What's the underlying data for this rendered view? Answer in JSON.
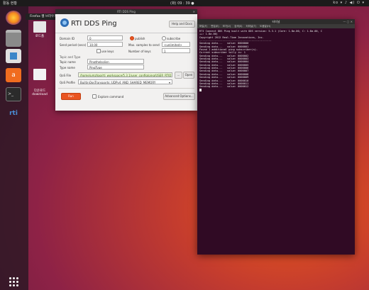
{
  "topbar": {
    "activities": "활동 현황",
    "clock": "(화) 09 : 39 ●",
    "tray": "ko ▾   ♪  ◀)  ⏻ ▾"
  },
  "dock": {
    "tooltip": "Firefox 웹 브라우저",
    "icons": [
      "firefox-icon",
      "files-icon",
      "software-icon",
      "amazon-icon",
      "terminal-icon",
      "rti-icon"
    ]
  },
  "desktop": [
    {
      "name": "desktop-folder-home",
      "label": "로드폴"
    },
    {
      "name": "desktop-folder-download",
      "label": "다운로드\ndownload"
    }
  ],
  "ping": {
    "window_title": "RTI DDS Ping",
    "title": "RTI DDS Ping",
    "help_label": "Help and Docs",
    "domain_label": "Domain ID",
    "domain_value": "0",
    "publish_label": "publish",
    "subscribe_label": "subscribe",
    "send_period_label": "Send period (secs)",
    "send_period_value": "10.00",
    "max_samples_label": "Max. samples to send",
    "max_samples_value": "<unlimited>",
    "use_keys_label": "use keys",
    "num_keys_label": "Number of keys",
    "num_keys_value": "1",
    "topic_section_label": "Topic and Type",
    "topic_name_label": "Topic name",
    "topic_name_value": "PingtheIsolisn",
    "type_name_label": "Type name",
    "type_name_value": "PingType",
    "qos_file_label": "QoS File",
    "qos_file_value": "/home/umzhao/rti_workspace/5.3.1/user_config/ping/USER_RTID",
    "qos_browse": "...",
    "open_label": "Open",
    "qos_profile_label": "QoS Profile",
    "qos_profile_value": "BuiltinQosTransports::UDPv4_AND_SHARED_MEMORY",
    "run_label": "Run",
    "explore_label": "Explore command",
    "advanced_label": "Advanced Options..."
  },
  "term": {
    "title": "터미널",
    "menu": [
      "파일(F)",
      "편집(E)",
      "보기(V)",
      "검색(S)",
      "터미널(T)",
      "도움말(H)"
    ],
    "lines": [
      "RTI Connext DDS Ping built with DDS version: 5.3.1 (Core: 1.8a.00, C: 1.8a.00, C",
      "++: 1.8a.00)",
      "Copyright 2012 Real-Time Innovations, Inc.",
      "-----------------------------------------------",
      "Sending data...   value: 0000000",
      "Sending data...   value: 0000001",
      "Found 1 additional ping subscriber(s).",
      "Current subscriber tally is: 1",
      "Sending data...   value: 0000002",
      "Sending data...   value: 0000003",
      "Sending data...   value: 0000004",
      "Sending data...   value: 0000005",
      "Sending data...   value: 0000006",
      "Sending data...   value: 0000007",
      "Sending data...   value: 0000008",
      "Sending data...   value: 0000009",
      "Sending data...   value: 0000010",
      "Sending data...   value: 0000011",
      "Sending data...   value: 0000012"
    ]
  }
}
